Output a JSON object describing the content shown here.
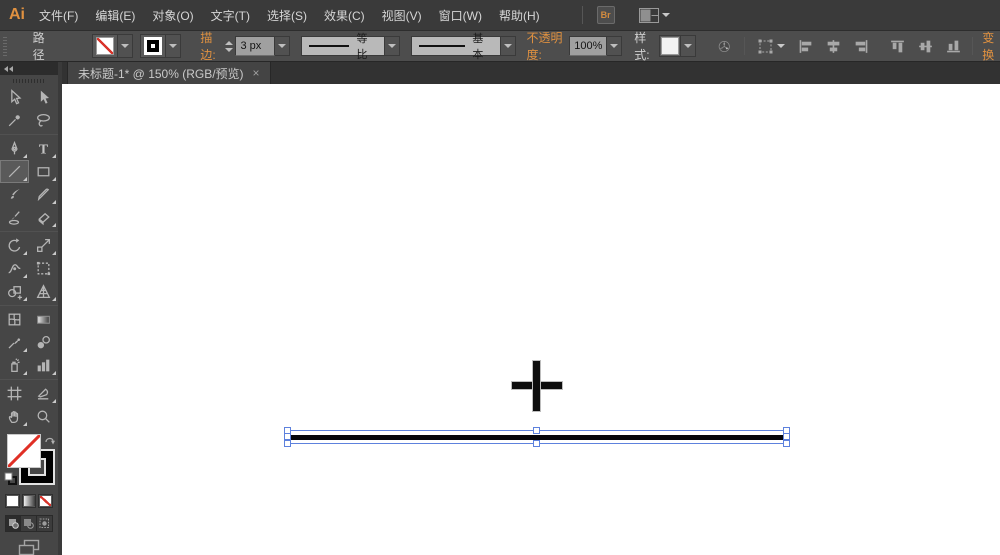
{
  "colors": {
    "accent_orange": "#e09140",
    "selection_blue": "#5d81dd",
    "ui_dark": "#3a3a3a",
    "canvas": "#ffffff"
  },
  "menu_bar": {
    "logo": "Ai",
    "items": [
      "文件(F)",
      "编辑(E)",
      "对象(O)",
      "文字(T)",
      "选择(S)",
      "效果(C)",
      "视图(V)",
      "窗口(W)",
      "帮助(H)"
    ],
    "bridge_button_label": "Br"
  },
  "control_bar": {
    "context_label": "路径",
    "stroke_label": "描边:",
    "stroke_width_value": "3 px",
    "width_profile_value": "等比",
    "brush_definition_value": "基本",
    "opacity_label": "不透明度:",
    "opacity_value": "100%",
    "style_label": "样式:",
    "transform_label": "变换"
  },
  "document_tab": {
    "title": "未标题-1* @ 150% (RGB/预览)",
    "close_label": "×"
  },
  "tools_panel": {
    "selected_tool": "line-segment",
    "tools": [
      "selection",
      "direct-selection",
      "magic-wand",
      "lasso",
      "pen",
      "type",
      "line-segment",
      "rectangle",
      "paintbrush",
      "pencil",
      "blob-brush",
      "eraser",
      "rotate",
      "scale",
      "width",
      "free-transform",
      "shape-builder",
      "perspective-grid",
      "mesh",
      "gradient",
      "eyedropper",
      "blend",
      "symbol-sprayer",
      "column-graph",
      "artboard",
      "slice",
      "hand",
      "zoom"
    ],
    "fill_swatch": "none",
    "stroke_swatch": "black"
  },
  "canvas": {
    "cursor": "plus-crosshair",
    "selection": {
      "object": "horizontal-line",
      "handle_count": 8
    }
  }
}
